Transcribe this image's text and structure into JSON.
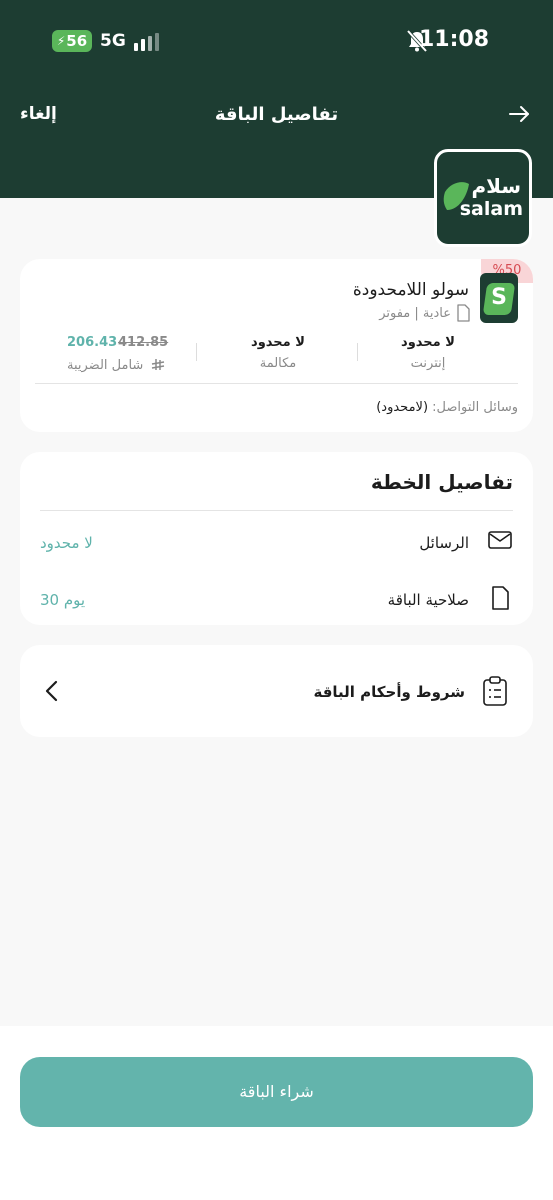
{
  "status_bar": {
    "time": "11:08",
    "network": "5G",
    "battery": "56"
  },
  "nav": {
    "title": "تفاصيل الباقة",
    "cancel_label": "إلغاء"
  },
  "brand": {
    "arabic": "سلام",
    "latin": "salam"
  },
  "plan": {
    "discount": "%50",
    "icon_letter": "S",
    "name": "سولو  اللامحدودة",
    "subtitle": "عادية | مفوتر",
    "internet_value": "لا محدود",
    "internet_label": "إنترنت",
    "calls_value": "لا محدود",
    "calls_label": "مكالمة",
    "price_new": "206.43",
    "price_old": "412.85",
    "tax_label": "شامل الضريبة",
    "social_label": "وسائل التواصل:",
    "social_value": "(لامحدود)"
  },
  "details": {
    "title": "تفاصيل الخطة",
    "messages_label": "الرسائل",
    "messages_value": "لا محدود",
    "validity_label": "صلاحية الباقة",
    "validity_value": "30  يوم"
  },
  "terms": {
    "label": "شروط وأحكام الباقة"
  },
  "buy_label": "شراء الباقة",
  "colors": {
    "header": "#1d3d32",
    "accent": "#63b4ac",
    "discount": "#d64b52",
    "logo_green": "#5ab65a"
  }
}
